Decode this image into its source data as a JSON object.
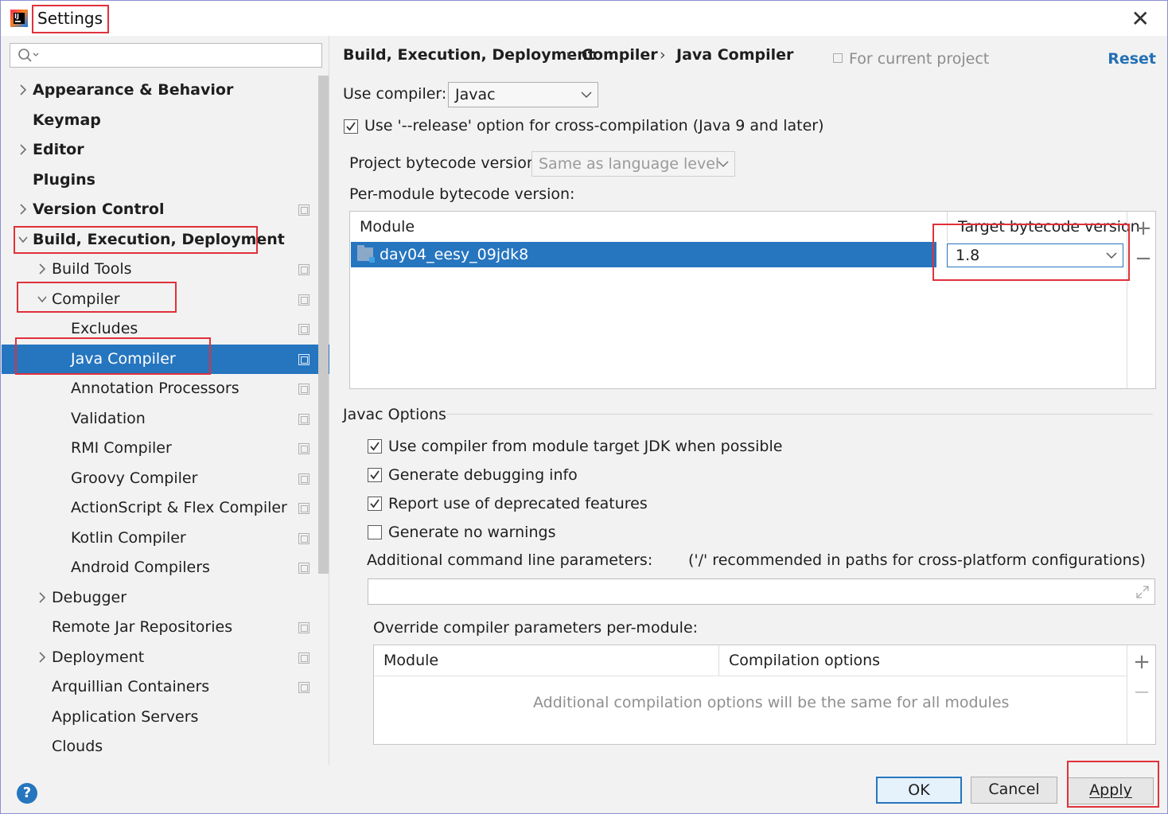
{
  "window": {
    "title": "Settings",
    "close_glyph": "✕",
    "icon_text": "IJ"
  },
  "sidebar": {
    "search_placeholder": "",
    "items": [
      {
        "label": "Appearance & Behavior",
        "bold": true,
        "expandable": true,
        "expanded": false,
        "project_icon": false
      },
      {
        "label": "Keymap",
        "bold": true,
        "expandable": false,
        "project_icon": false
      },
      {
        "label": "Editor",
        "bold": true,
        "expandable": true,
        "expanded": false,
        "project_icon": false
      },
      {
        "label": "Plugins",
        "bold": true,
        "expandable": false,
        "project_icon": false
      },
      {
        "label": "Version Control",
        "bold": true,
        "expandable": true,
        "expanded": false,
        "project_icon": true
      },
      {
        "label": "Build, Execution, Deployment",
        "bold": true,
        "expandable": true,
        "expanded": true,
        "project_icon": false
      },
      {
        "label": "Build Tools",
        "bold": false,
        "expandable": true,
        "expanded": false,
        "project_icon": true
      },
      {
        "label": "Compiler",
        "bold": false,
        "expandable": true,
        "expanded": true,
        "project_icon": true
      },
      {
        "label": "Excludes",
        "bold": false,
        "expandable": false,
        "project_icon": true
      },
      {
        "label": "Java Compiler",
        "bold": false,
        "expandable": false,
        "project_icon": true,
        "selected": true
      },
      {
        "label": "Annotation Processors",
        "bold": false,
        "expandable": false,
        "project_icon": true
      },
      {
        "label": "Validation",
        "bold": false,
        "expandable": false,
        "project_icon": true
      },
      {
        "label": "RMI Compiler",
        "bold": false,
        "expandable": false,
        "project_icon": true
      },
      {
        "label": "Groovy Compiler",
        "bold": false,
        "expandable": false,
        "project_icon": true
      },
      {
        "label": "ActionScript & Flex Compiler",
        "bold": false,
        "expandable": false,
        "project_icon": true
      },
      {
        "label": "Kotlin Compiler",
        "bold": false,
        "expandable": false,
        "project_icon": true
      },
      {
        "label": "Android Compilers",
        "bold": false,
        "expandable": false,
        "project_icon": true
      },
      {
        "label": "Debugger",
        "bold": false,
        "expandable": true,
        "expanded": false,
        "project_icon": false
      },
      {
        "label": "Remote Jar Repositories",
        "bold": false,
        "expandable": false,
        "project_icon": true
      },
      {
        "label": "Deployment",
        "bold": false,
        "expandable": true,
        "expanded": false,
        "project_icon": true
      },
      {
        "label": "Arquillian Containers",
        "bold": false,
        "expandable": false,
        "project_icon": true
      },
      {
        "label": "Application Servers",
        "bold": false,
        "expandable": false,
        "project_icon": false
      },
      {
        "label": "Clouds",
        "bold": false,
        "expandable": false,
        "project_icon": false
      }
    ]
  },
  "header": {
    "breadcrumb": [
      "Build, Execution, Deployment",
      "Compiler",
      "Java Compiler"
    ],
    "separator": "›",
    "for_current_project": "For current project",
    "reset": "Reset"
  },
  "compiler": {
    "use_compiler_label": "Use compiler:",
    "use_compiler_value": "Javac",
    "release_option_label": "Use '--release' option for cross-compilation (Java 9 and later)",
    "release_option_checked": true,
    "project_bytecode_label": "Project bytecode version:",
    "project_bytecode_value": "Same as language level",
    "per_module_label": "Per-module bytecode version:",
    "module_table": {
      "col_module": "Module",
      "col_target": "Target bytecode version",
      "rows": [
        {
          "module": "day04_eesy_09jdk8",
          "target": "1.8"
        }
      ]
    }
  },
  "javac_options": {
    "section_title": "Javac Options",
    "checkboxes": [
      {
        "label": "Use compiler from module target JDK when possible",
        "checked": true
      },
      {
        "label": "Generate debugging info",
        "checked": true
      },
      {
        "label": "Report use of deprecated features",
        "checked": true
      },
      {
        "label": "Generate no warnings",
        "checked": false
      }
    ],
    "additional_params_label": "Additional command line parameters:",
    "additional_params_hint": "('/' recommended in paths for cross-platform configurations)",
    "additional_params_value": "",
    "override_label": "Override compiler parameters per-module:",
    "override_table": {
      "col_module": "Module",
      "col_options": "Compilation options",
      "empty_text": "Additional compilation options will be the same for all modules"
    }
  },
  "footer": {
    "help": "?",
    "ok": "OK",
    "cancel": "Cancel",
    "apply": "Apply"
  },
  "colors": {
    "selection": "#2675bf",
    "highlight_box": "#e0313a",
    "link": "#2470b3"
  }
}
